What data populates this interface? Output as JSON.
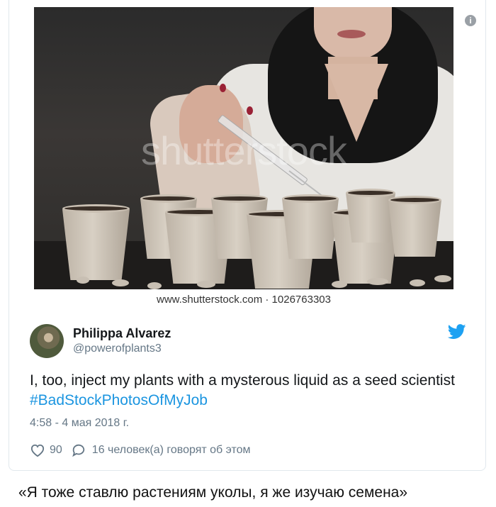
{
  "media": {
    "watermark_text": "shutterstock",
    "caption": "www.shutterstock.com · 1026763303",
    "info_icon": "info-icon"
  },
  "tweet": {
    "author_name": "Philippa Alvarez",
    "author_handle": "@powerofplants3",
    "text_plain": "I, too, inject my plants with a mysterous liquid as a seed scientist ",
    "hashtag": "#BadStockPhotosOfMyJob",
    "timestamp": "4:58 - 4 мая 2018 г.",
    "like_count": "90",
    "reply_text": "16 человек(а) говорят об этом",
    "brand_icon": "twitter-bird-icon",
    "colors": {
      "link": "#1b95e0",
      "muted": "#657786",
      "brand": "#1da1f2"
    }
  },
  "caption_ru": "«Я тоже ставлю растениям уколы, я же изучаю семена»"
}
